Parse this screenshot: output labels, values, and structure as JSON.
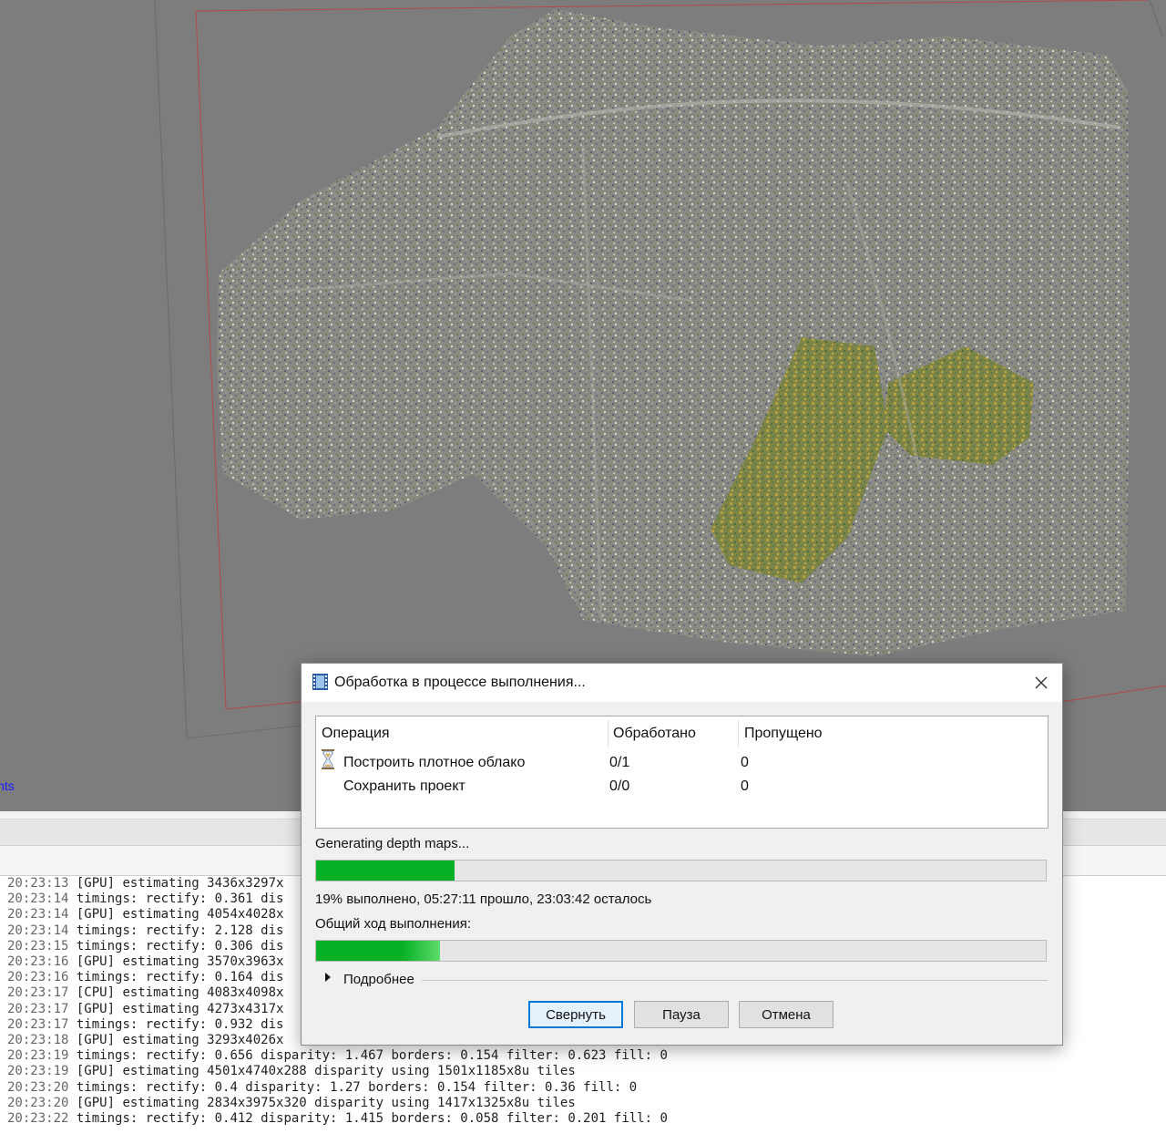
{
  "viewport": {
    "corner_label": "ints",
    "background_color": "#7d7d7d",
    "box_color": "#b44a4a"
  },
  "console": {
    "lines": [
      {
        "time": "20:23:13",
        "text": "[GPU] estimating 3436x3297x"
      },
      {
        "time": "20:23:14",
        "text": "timings: rectify: 0.361 dis"
      },
      {
        "time": "20:23:14",
        "text": "[GPU] estimating 4054x4028x"
      },
      {
        "time": "20:23:14",
        "text": "timings: rectify: 2.128 dis"
      },
      {
        "time": "20:23:15",
        "text": "timings: rectify: 0.306 dis"
      },
      {
        "time": "20:23:16",
        "text": "[GPU] estimating 3570x3963x"
      },
      {
        "time": "20:23:16",
        "text": "timings: rectify: 0.164 dis"
      },
      {
        "time": "20:23:17",
        "text": "[CPU] estimating 4083x4098x"
      },
      {
        "time": "20:23:17",
        "text": "[GPU] estimating 4273x4317x"
      },
      {
        "time": "20:23:17",
        "text": "timings: rectify: 0.932 dis"
      },
      {
        "time": "20:23:18",
        "text": "[GPU] estimating 3293x4026x"
      },
      {
        "time": "20:23:19",
        "text": "timings: rectify: 0.656 disparity: 1.467 borders: 0.154 filter: 0.623 fill: 0"
      },
      {
        "time": "20:23:19",
        "text": "[GPU] estimating 4501x4740x288 disparity using 1501x1185x8u tiles"
      },
      {
        "time": "20:23:20",
        "text": "timings: rectify: 0.4 disparity: 1.27 borders: 0.154 filter: 0.36 fill: 0"
      },
      {
        "time": "20:23:20",
        "text": "[GPU] estimating 2834x3975x320 disparity using 1417x1325x8u tiles"
      },
      {
        "time": "20:23:22",
        "text": "timings: rectify: 0.412 disparity: 1.415 borders: 0.058 filter: 0.201 fill: 0"
      }
    ]
  },
  "dialog": {
    "title": "Обработка в процессе выполнения...",
    "icon": "film-strip-icon",
    "close_icon": "close-icon",
    "table": {
      "headers": [
        "Операция",
        "Обработано",
        "Пропущено"
      ],
      "rows": [
        {
          "operation": "Построить плотное облако",
          "processed": "0/1",
          "skipped": "0",
          "icon": "hourglass-icon"
        },
        {
          "operation": "Сохранить проект",
          "processed": "0/0",
          "skipped": "0",
          "icon": ""
        }
      ]
    },
    "stage_label": "Generating depth maps...",
    "stage_progress": 0.19,
    "stage_status": "19% выполнено, 05:27:11 прошло, 23:03:42 осталось",
    "overall_label": "Общий ход выполнения:",
    "overall_progress": 0.17,
    "details_label": "Подробнее",
    "buttons": {
      "minimize": "Свернуть",
      "pause": "Пауза",
      "cancel": "Отмена"
    },
    "progress_color": "#06b025",
    "accent_color": "#0078d7"
  }
}
